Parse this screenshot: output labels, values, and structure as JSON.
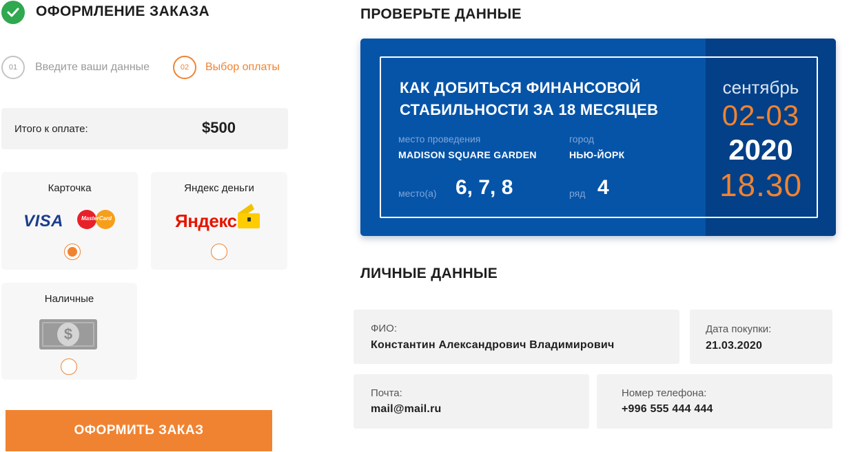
{
  "header": {
    "title": "ОФОРМЛЕНИЕ ЗАКАЗА"
  },
  "steps": [
    {
      "num": "01",
      "label": "Введите ваши данные"
    },
    {
      "num": "02",
      "label": "Выбор оплаты"
    }
  ],
  "total": {
    "label": "Итого к оплате:",
    "value": "$500"
  },
  "payment": {
    "card": {
      "label": "Карточка",
      "visa": "VISA",
      "mastercard": "MasterCard"
    },
    "yandex": {
      "label": "Яндекс деньги",
      "logo": "Яндекс"
    },
    "cash": {
      "label": "Наличные",
      "symbol": "$"
    },
    "selected": "card"
  },
  "submit_label": "ОФОРМИТЬ ЗАКАЗ",
  "check": {
    "title": "ПРОВЕРЬТЕ ДАННЫЕ",
    "event_title": "КАК ДОБИТЬСЯ ФИНАНСОВОЙ СТАБИЛЬНОСТИ ЗА 18 МЕСЯЦЕВ",
    "venue_label": "место проведения",
    "venue": "MADISON SQUARE GARDEN",
    "city_label": "город",
    "city": "НЬЮ-ЙОРК",
    "seats_label": "место(а)",
    "seats": "6, 7, 8",
    "row_label": "ряд",
    "row": "4",
    "month": "сентябрь",
    "days": "02-03",
    "year": "2020",
    "time": "18.30"
  },
  "personal": {
    "title": "ЛИЧНЫЕ ДАННЫЕ",
    "name_label": "ФИО:",
    "name": "Константин Александрович Владимирович",
    "date_label": "Дата покупки:",
    "date": "21.03.2020",
    "email_label": "Почта:",
    "email": "mail@mail.ru",
    "phone_label": "Номер телефона:",
    "phone": "+996 555 444 444"
  },
  "colors": {
    "accent": "#f08331",
    "ticket_blue": "#0654a8",
    "ticket_dark": "#044087",
    "success": "#2fa84f"
  }
}
